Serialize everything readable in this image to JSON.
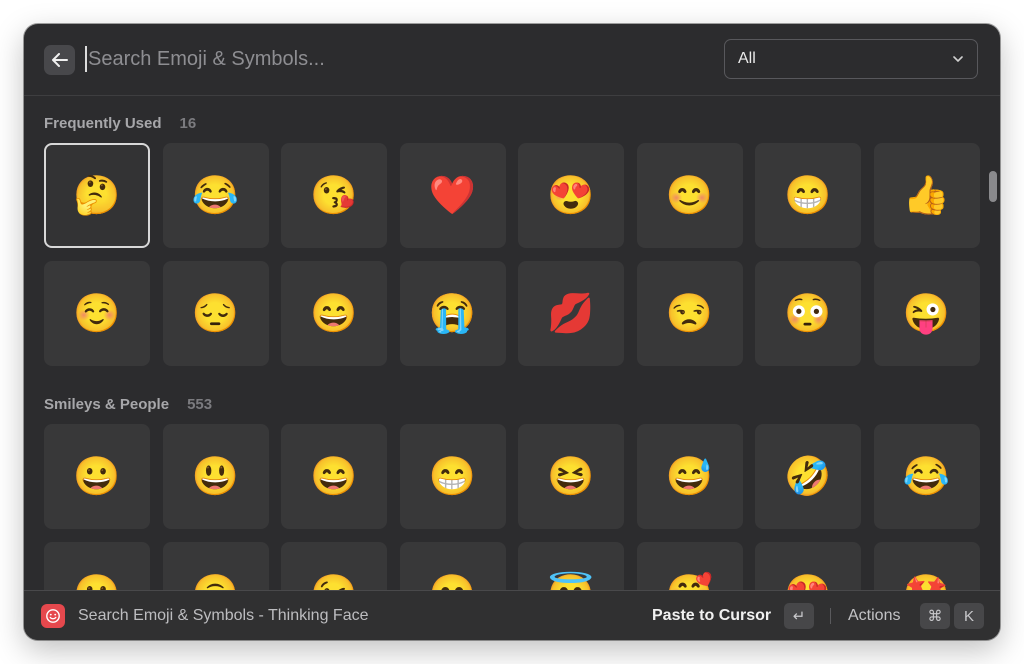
{
  "search": {
    "placeholder": "Search Emoji & Symbols..."
  },
  "filter": {
    "selected": "All"
  },
  "sections": [
    {
      "title": "Frequently Used",
      "count": "16",
      "emojis": [
        "🤔",
        "😂",
        "😘",
        "❤️",
        "😍",
        "😊",
        "😁",
        "👍",
        "☺️",
        "😔",
        "😄",
        "😭",
        "💋",
        "😒",
        "😳",
        "😜"
      ]
    },
    {
      "title": "Smileys & People",
      "count": "553",
      "emojis": [
        "😀",
        "😃",
        "😄",
        "😁",
        "😆",
        "😅",
        "🤣",
        "😂",
        "🙂",
        "🙃",
        "😉",
        "😊",
        "😇",
        "🥰",
        "😍",
        "🤩"
      ]
    }
  ],
  "selected_emoji": "🤔",
  "footer": {
    "title": "Search Emoji & Symbols - Thinking Face",
    "primary_action": "Paste to Cursor",
    "enter_key": "↵",
    "actions_label": "Actions",
    "cmd_key": "⌘",
    "k_key": "K"
  },
  "colors": {
    "window_bg": "#2c2c2e",
    "tile_bg": "#383839",
    "app_icon": "#e5484d"
  }
}
